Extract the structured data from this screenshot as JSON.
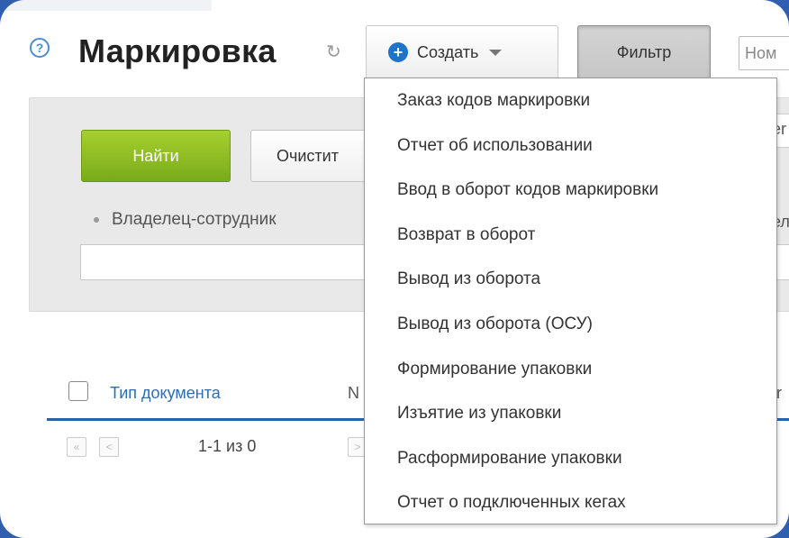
{
  "header": {
    "help_icon": "?",
    "title": "Маркировка",
    "refresh_icon": "↻",
    "create_label": "Создать",
    "filter_label": "Фильтр",
    "search_placeholder": "Ном"
  },
  "filter_panel": {
    "find_label": "Найти",
    "clear_label": "Очистит",
    "owner_label": "Владелец-сотрудник",
    "right_fragment_1": "er",
    "right_fragment_2": "ел"
  },
  "table": {
    "col_doc_type": "Тип документа",
    "col_number": "N",
    "col_right_fragment": "r",
    "pager_first": "«",
    "pager_prev": "<",
    "pager_next": ">",
    "pager_range": "1-1 из 0"
  },
  "create_menu": {
    "items": [
      "Заказ кодов маркировки",
      "Отчет об использовании",
      "Ввод в оборот кодов маркировки",
      "Возврат в оборот",
      "Вывод из оборота",
      "Вывод из оборота (ОСУ)",
      "Формирование упаковки",
      "Изъятие из упаковки",
      "Расформирование упаковки",
      "Отчет о подключенных кегах"
    ]
  },
  "colors": {
    "accent_blue": "#1f73c9",
    "find_green": "#8cbd22",
    "link_blue": "#2d6db3",
    "frame_blue": "#2f5fae"
  }
}
